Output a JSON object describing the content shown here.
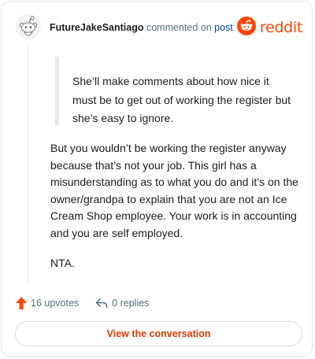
{
  "header": {
    "username": "FutureJakeSantiago",
    "commented_text": "commented on",
    "post_link": "post",
    "logo_text": "reddit"
  },
  "quote": {
    "text": "She’ll make comments about how nice it must be to get out of working the register but she’s easy to ignore."
  },
  "comment": {
    "paragraph_1": "But you wouldn’t be working the register anyway because that’s not your job. This girl has a misunderstanding as to what you do and it’s on the owner/grandpa to explain that you are not an Ice Cream Shop employee. Your work is in accounting and you are self employed.",
    "paragraph_2": "NTA."
  },
  "actions": {
    "upvotes": "16 upvotes",
    "replies": "0 replies"
  },
  "footer": {
    "button_label": "View the conversation"
  },
  "colors": {
    "brand": "#ff4500",
    "link": "#0045ac",
    "button_text": "#d93a00",
    "muted": "#576f76"
  },
  "icons": {
    "avatar": "snoo-avatar-icon",
    "logo": "reddit-logo-icon",
    "upvote": "upvote-arrow-icon",
    "reply": "reply-arrow-icon"
  }
}
